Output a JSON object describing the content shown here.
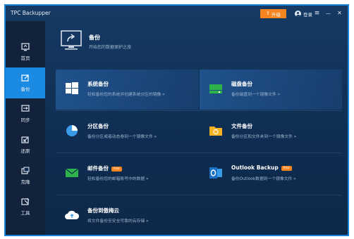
{
  "app": {
    "title": "TPC Backupper",
    "upgrade_label": "升级",
    "upgrade_icon": "up-arrow-icon",
    "login_label": "登录",
    "menu_icon": "≡",
    "minimize_icon": "—",
    "close_icon": "✕"
  },
  "colors": {
    "accent": "#1b8ae3",
    "upgrade": "#f6841f",
    "sidebar_bg": "#11223a",
    "window_bg": "#163a63",
    "green_icon": "#2db34a",
    "orange_icon": "#f6841f",
    "blue_icon": "#3a9be8"
  },
  "sidebar": {
    "items": [
      {
        "label": "首页",
        "icon": "home-icon",
        "active": false
      },
      {
        "label": "备份",
        "icon": "backup-icon",
        "active": true
      },
      {
        "label": "同步",
        "icon": "sync-icon",
        "active": false
      },
      {
        "label": "还原",
        "icon": "restore-icon",
        "active": false
      },
      {
        "label": "克隆",
        "icon": "clone-icon",
        "active": false
      },
      {
        "label": "工具",
        "icon": "tools-icon",
        "active": false
      }
    ]
  },
  "header": {
    "title": "备份",
    "subtitle": "开始您的数据保护之旅"
  },
  "cards": [
    {
      "title": "系统备份",
      "desc": "轻松备份您的系统并创建系统分区的镜像 »",
      "icon": "windows-icon",
      "badge": ""
    },
    {
      "title": "磁盘备份",
      "desc": "备份磁盘到一个镜像文件 »",
      "icon": "disk-icon",
      "badge": ""
    },
    {
      "title": "分区备份",
      "desc": "备份分区或者动态卷到一个镜像文件 »",
      "icon": "partition-icon",
      "badge": ""
    },
    {
      "title": "文件备份",
      "desc": "备份分区和文件夹到一个镜像文件 »",
      "icon": "folder-icon",
      "badge": ""
    },
    {
      "title": "邮件备份",
      "desc": "轻松备份您的邮箱账号中的数据 »",
      "icon": "mail-icon",
      "badge": "free"
    },
    {
      "title": "Outlook Backup",
      "desc": "备份Outlook数据到一个镜像文件 »",
      "icon": "outlook-icon",
      "badge": "free"
    },
    {
      "title": "备份到傲梅云",
      "desc": "将文件备份至安全可靠的云存储 »",
      "icon": "cloud-icon",
      "badge": ""
    }
  ]
}
